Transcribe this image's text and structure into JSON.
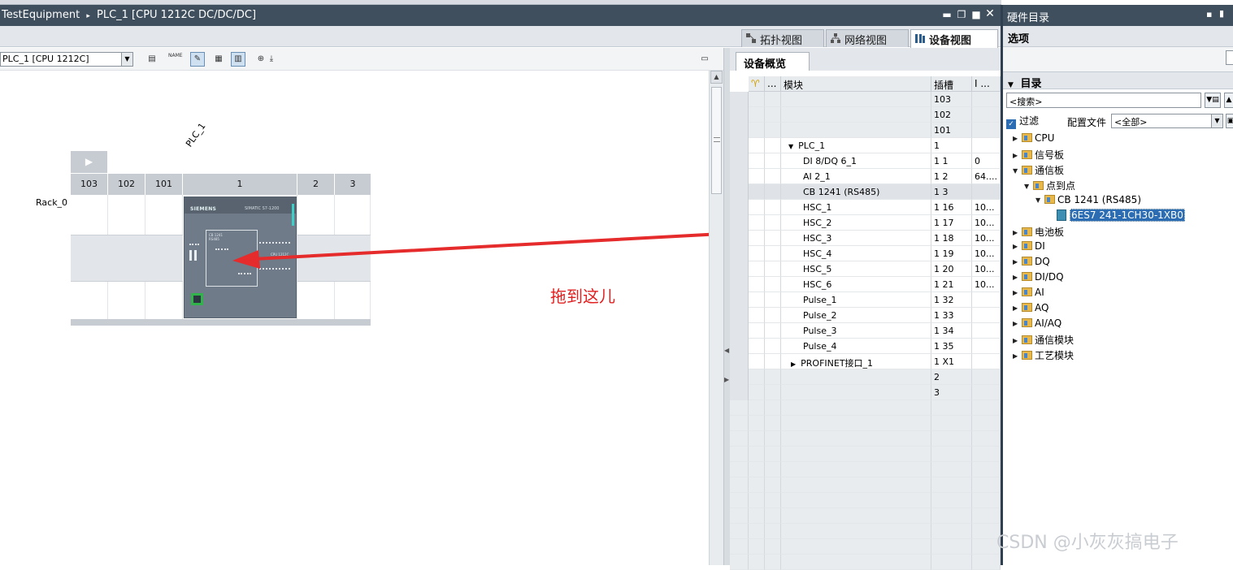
{
  "title_bar": {
    "breadcrumb_project": "TestEquipment",
    "breadcrumb_sep": "▸",
    "breadcrumb_device": "PLC_1 [CPU 1212C DC/DC/DC]"
  },
  "view_tabs": [
    {
      "label": "拓扑视图",
      "icon": "topology-icon"
    },
    {
      "label": "网络视图",
      "icon": "network-icon"
    },
    {
      "label": "设备视图",
      "icon": "device-icon",
      "active": true
    }
  ],
  "editor_toolbar": {
    "device_select_value": "PLC_1 [CPU 1212C]",
    "name_label": "NAME"
  },
  "rack": {
    "device_label": "PLC_1",
    "rack_label": "Rack_0",
    "slots": [
      "103",
      "102",
      "101",
      "1",
      "2",
      "3"
    ],
    "plc_brand": "SIEMENS",
    "plc_series": "SIMATIC S7-1200",
    "cb_label_1": "CB 1241",
    "cb_label_2": "RS485",
    "cpu_tag": "CPU 1212C"
  },
  "annotation": "拖到这儿",
  "overview": {
    "tab_label": "设备概览",
    "headers": {
      "col2": "...",
      "module": "模块",
      "slot": "插槽",
      "addr": "I ..."
    },
    "rows": [
      {
        "module": "",
        "slot": "103",
        "addr": ""
      },
      {
        "module": "",
        "slot": "102",
        "addr": ""
      },
      {
        "module": "",
        "slot": "101",
        "addr": ""
      },
      {
        "module": "PLC_1",
        "slot": "1",
        "addr": "",
        "expand": "▼",
        "indent": 1
      },
      {
        "module": "DI 8/DQ 6_1",
        "slot": "1 1",
        "addr": "0",
        "indent": 2
      },
      {
        "module": "AI 2_1",
        "slot": "1 2",
        "addr": "64....",
        "indent": 2
      },
      {
        "module": "CB 1241 (RS485)",
        "slot": "1 3",
        "addr": "",
        "indent": 2,
        "selected": true
      },
      {
        "module": "HSC_1",
        "slot": "1 16",
        "addr": "10...",
        "indent": 2
      },
      {
        "module": "HSC_2",
        "slot": "1 17",
        "addr": "10...",
        "indent": 2
      },
      {
        "module": "HSC_3",
        "slot": "1 18",
        "addr": "10...",
        "indent": 2
      },
      {
        "module": "HSC_4",
        "slot": "1 19",
        "addr": "10...",
        "indent": 2
      },
      {
        "module": "HSC_5",
        "slot": "1 20",
        "addr": "10...",
        "indent": 2
      },
      {
        "module": "HSC_6",
        "slot": "1 21",
        "addr": "10...",
        "indent": 2
      },
      {
        "module": "Pulse_1",
        "slot": "1 32",
        "addr": "",
        "indent": 2
      },
      {
        "module": "Pulse_2",
        "slot": "1 33",
        "addr": "",
        "indent": 2
      },
      {
        "module": "Pulse_3",
        "slot": "1 34",
        "addr": "",
        "indent": 2
      },
      {
        "module": "Pulse_4",
        "slot": "1 35",
        "addr": "",
        "indent": 2
      },
      {
        "module": "PROFINET接口_1",
        "slot": "1 X1",
        "addr": "",
        "expand": "▶",
        "indent": 2
      },
      {
        "module": "",
        "slot": "2",
        "addr": ""
      },
      {
        "module": "",
        "slot": "3",
        "addr": ""
      }
    ]
  },
  "catalog": {
    "title": "硬件目录",
    "options_label": "选项",
    "directory_label": "目录",
    "search_placeholder": "<搜索>",
    "filter_label": "过滤",
    "profile_label": "配置文件",
    "profile_value": "<全部>",
    "tree": [
      {
        "label": "CPU",
        "level": 0,
        "arrow": "▶"
      },
      {
        "label": "信号板",
        "level": 0,
        "arrow": "▶"
      },
      {
        "label": "通信板",
        "level": 0,
        "arrow": "▼"
      },
      {
        "label": "点到点",
        "level": 1,
        "arrow": "▼"
      },
      {
        "label": "CB 1241 (RS485)",
        "level": 2,
        "arrow": "▼"
      },
      {
        "label": "6ES7 241-1CH30-1XB0",
        "level": 3,
        "arrow": "",
        "module": true,
        "highlight": true
      },
      {
        "label": "电池板",
        "level": 0,
        "arrow": "▶"
      },
      {
        "label": "DI",
        "level": 0,
        "arrow": "▶"
      },
      {
        "label": "DQ",
        "level": 0,
        "arrow": "▶"
      },
      {
        "label": "DI/DQ",
        "level": 0,
        "arrow": "▶"
      },
      {
        "label": "AI",
        "level": 0,
        "arrow": "▶"
      },
      {
        "label": "AQ",
        "level": 0,
        "arrow": "▶"
      },
      {
        "label": "AI/AQ",
        "level": 0,
        "arrow": "▶"
      },
      {
        "label": "通信模块",
        "level": 0,
        "arrow": "▶"
      },
      {
        "label": "工艺模块",
        "level": 0,
        "arrow": "▶"
      }
    ]
  },
  "watermark": "CSDN @小灰灰搞电子",
  "colors": {
    "title_bar": "#3f4f5e",
    "selection": "#2b6cb3",
    "annotation": "#e02020",
    "plc_body": "#6f7b89"
  }
}
